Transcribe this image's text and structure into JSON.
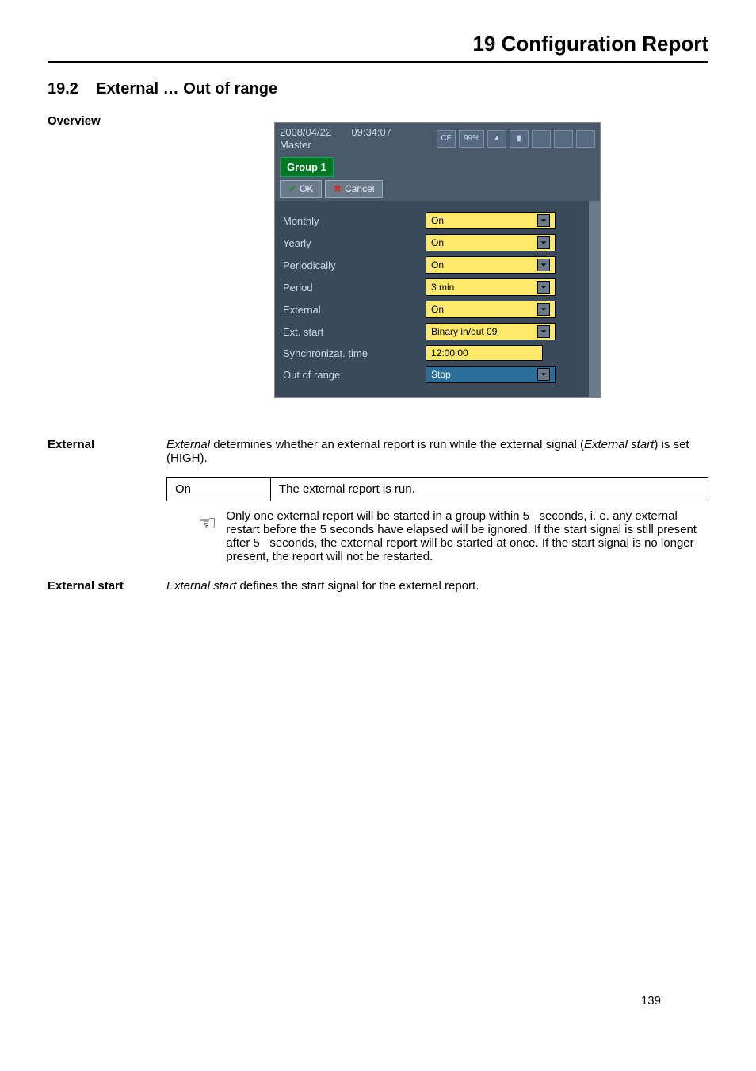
{
  "header": {
    "title": "19 Configuration Report"
  },
  "section": {
    "number": "19.2",
    "title": "External … Out of range"
  },
  "overview_label": "Overview",
  "screenshot": {
    "date": "2008/04/22",
    "time": "09:34:07",
    "master": "Master",
    "cf": "CF",
    "pct": "99%",
    "group_tab": "Group 1",
    "ok": "OK",
    "cancel": "Cancel",
    "rows": {
      "monthly": {
        "label": "Monthly",
        "value": "On"
      },
      "yearly": {
        "label": "Yearly",
        "value": "On"
      },
      "periodic": {
        "label": "Periodically",
        "value": "On"
      },
      "period": {
        "label": "Period",
        "value": "3 min"
      },
      "external": {
        "label": "External",
        "value": "On"
      },
      "extstart": {
        "label": "Ext. start",
        "value": "Binary in/out 09"
      },
      "sync": {
        "label": "Synchronizat. time",
        "value": "12:00:00"
      },
      "outrange": {
        "label": "Out of range",
        "value": "Stop"
      }
    }
  },
  "external": {
    "label": "External",
    "para_before_ital1": "External",
    "para_mid": " determines whether an external report is run while the external signal (",
    "para_ital2": "External start",
    "para_after": ") is set (HIGH).",
    "table": {
      "col1": "On",
      "col2": "The external report is run."
    },
    "note": "Only one external report will be started in a group within 5   seconds, i. e. any external restart before the 5 seconds have elapsed will be ignored. If the start signal is still present after 5   seconds, the external report will be started at once. If the start signal is no longer present, the report will not be restarted."
  },
  "external_start": {
    "label": "External start",
    "ital": "External start",
    "rest": " defines the start signal for the external report."
  },
  "page_number": "139"
}
